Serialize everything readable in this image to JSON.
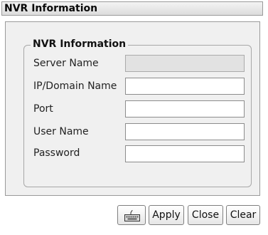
{
  "window": {
    "title": "NVR Information"
  },
  "group": {
    "title": "NVR Information"
  },
  "fields": [
    {
      "label": "Server Name",
      "value": "",
      "disabled": true
    },
    {
      "label": "IP/Domain Name",
      "value": ""
    },
    {
      "label": "Port",
      "value": ""
    },
    {
      "label": "User Name",
      "value": ""
    },
    {
      "label": "Password",
      "value": ""
    }
  ],
  "buttons": {
    "keyboard_icon": "keyboard-icon",
    "apply_label": "Apply",
    "close_label": "Close",
    "clear_label": "Clear"
  }
}
